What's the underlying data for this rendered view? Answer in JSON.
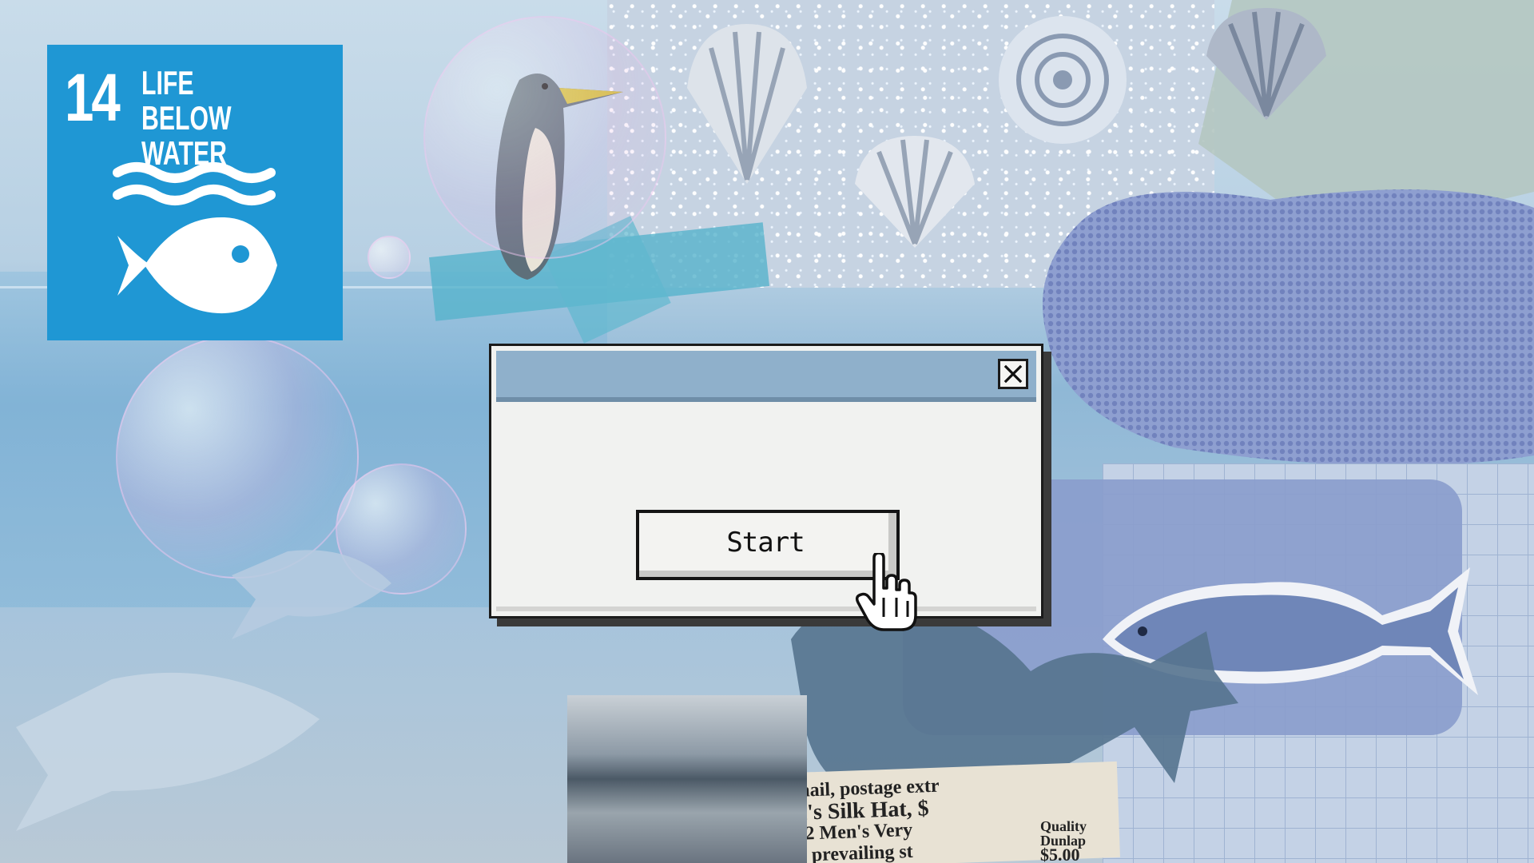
{
  "badge": {
    "number": "14",
    "title_lines": [
      "LIFE BELOW",
      "WATER"
    ],
    "color": "#1f97d4",
    "icon": "waves-and-fish-icon"
  },
  "dialog": {
    "title": "",
    "close_icon": "close-icon",
    "start_label": "Start"
  },
  "cursor": {
    "icon": "hand-pointer-icon"
  },
  "collage_text": {
    "line1": "mail, postage extr",
    "line2": "n's Silk Hat, $",
    "line3": "62  Men's Very",
    "line4": "n prevailing st",
    "line5": "Quality",
    "line6": "Dunlap",
    "line7": "$5.00"
  },
  "colors": {
    "titlebar": "#8fb0cb",
    "dialog_bg": "#f1f2f0",
    "border": "#1b1b1b"
  }
}
